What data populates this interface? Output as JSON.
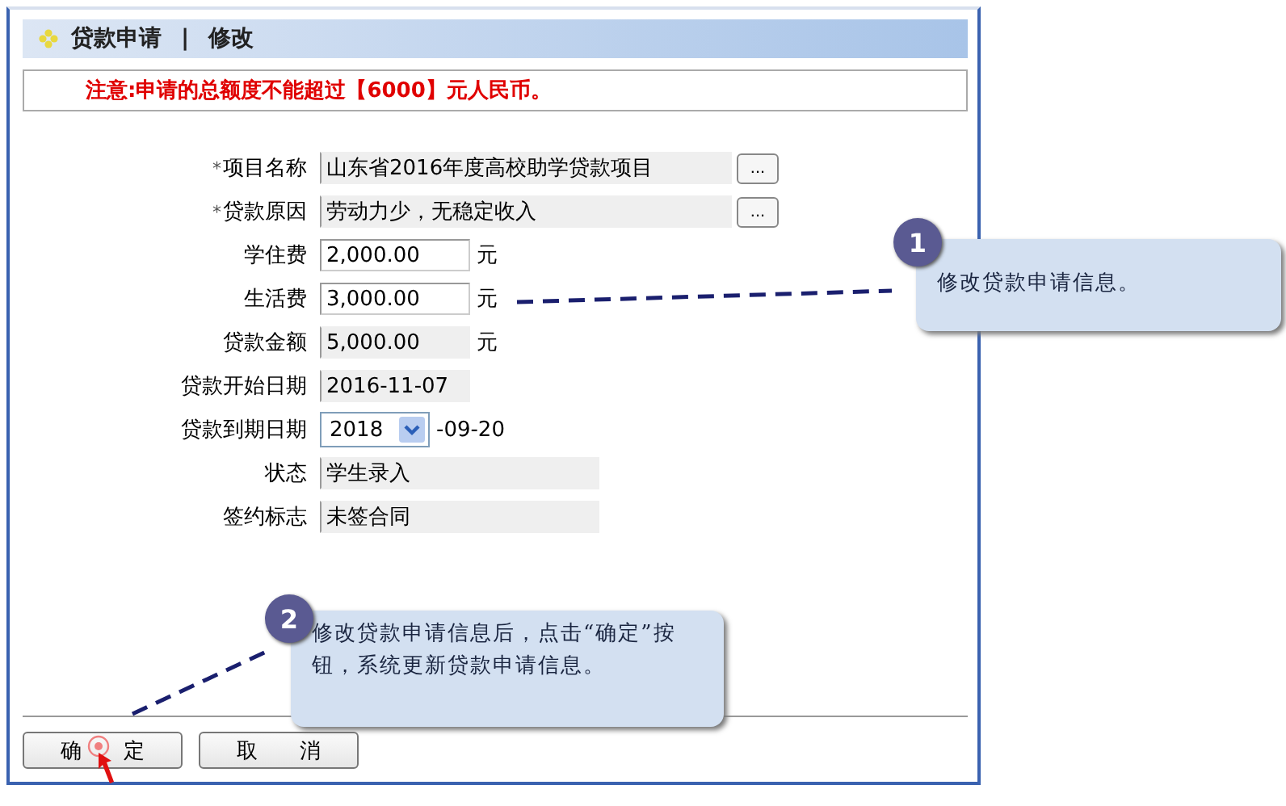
{
  "header": {
    "title": "贷款申请",
    "separator": "|",
    "subtitle": "修改"
  },
  "notice": "注意:申请的总额度不能超过【6000】元人民币。",
  "form": [
    {
      "label": "项目名称",
      "required_mark": "*",
      "kind": "lookup",
      "value": "山东省2016年度高校助学贷款项目",
      "editable": false,
      "button": "..."
    },
    {
      "label": "贷款原因",
      "required_mark": "*",
      "kind": "lookup",
      "value": "劳动力少，无稳定收入",
      "editable": false,
      "button": "..."
    },
    {
      "label": "学住费",
      "kind": "amount",
      "value": "2,000.00",
      "editable": true,
      "unit": "元"
    },
    {
      "label": "生活费",
      "kind": "amount",
      "value": "3,000.00",
      "editable": true,
      "unit": "元"
    },
    {
      "label": "贷款金额",
      "kind": "amount",
      "value": "5,000.00",
      "editable": false,
      "unit": "元"
    },
    {
      "label": "贷款开始日期",
      "kind": "short",
      "value": "2016-11-07",
      "editable": false
    },
    {
      "label": "贷款到期日期",
      "kind": "select",
      "value": "2018",
      "suffix": "-09-20"
    },
    {
      "label": "状态",
      "kind": "wide",
      "value": "学生录入",
      "editable": false
    },
    {
      "label": "签约标志",
      "kind": "wide",
      "value": "未签合同",
      "editable": false
    }
  ],
  "buttons": [
    "确 定",
    "取 消"
  ],
  "callouts": [
    {
      "number": "1",
      "text": "修改贷款申请信息。"
    },
    {
      "number": "2",
      "text": "修改贷款申请信息后，点击“确定”按钮，系统更新贷款申请信息。"
    }
  ]
}
